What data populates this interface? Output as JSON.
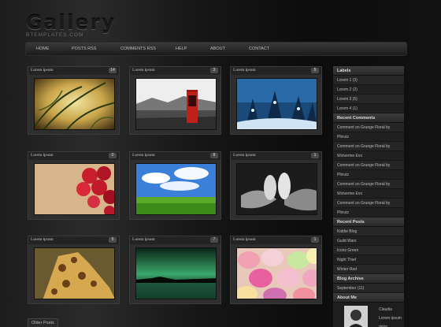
{
  "header": {
    "title": "Gallery",
    "subtitle": "BTEMPLATES.COM"
  },
  "nav": {
    "items": [
      "HOME",
      "POSTS RSS",
      "COMMENTS RSS",
      "HELP",
      "ABOUT",
      "CONTACT"
    ]
  },
  "posts": [
    {
      "title": "Lorem ipsum",
      "count": "14",
      "image": "grunge-floral"
    },
    {
      "title": "Lorem ipsum",
      "count": "3",
      "image": "phone-booth"
    },
    {
      "title": "Lorem ipsum",
      "count": "5",
      "image": "snowy-forest"
    },
    {
      "title": "Lorem ipsum",
      "count": "0",
      "image": "rose-petals"
    },
    {
      "title": "Lorem ipsum",
      "count": "8",
      "image": "green-field"
    },
    {
      "title": "Lorem ipsum",
      "count": "1",
      "image": "baby-feet"
    },
    {
      "title": "Lorem ipsum",
      "count": "5",
      "image": "giraffe"
    },
    {
      "title": "Lorem ipsum",
      "count": "7",
      "image": "aurora"
    },
    {
      "title": "Lorem ipsum",
      "count": "1",
      "image": "candy-hearts"
    }
  ],
  "older_posts": "Older Posts",
  "sidebar": {
    "labels": {
      "heading": "Labels",
      "items": [
        "Lorem 1 (3)",
        "Lorem 2 (2)",
        "Lorem 3 (5)",
        "Lorem 4 (1)"
      ]
    },
    "recent_comments": {
      "heading": "Recent Comments",
      "items": [
        "Comment on Grunge Floral by",
        "Plinutz",
        "Comment on Grunge Floral by",
        "Wolverine Evo",
        "Comment on Grunge Floral by",
        "Plinutz",
        "Comment on Grunge Floral by",
        "Wolverine Evo",
        "Comment on Grunge Floral by",
        "Plinutz"
      ]
    },
    "recent_posts": {
      "heading": "Recent Posts",
      "items": [
        "Kiddie Blog",
        "Guild Wars",
        "Icons Green",
        "Night Thief",
        "Winter Red"
      ]
    },
    "blog_archive": {
      "heading": "Blog Archive",
      "items": [
        "September (11)"
      ]
    },
    "about_me": {
      "heading": "About Me",
      "lines": [
        "Claudia",
        "Lorem ipsum",
        "dolor"
      ]
    }
  }
}
